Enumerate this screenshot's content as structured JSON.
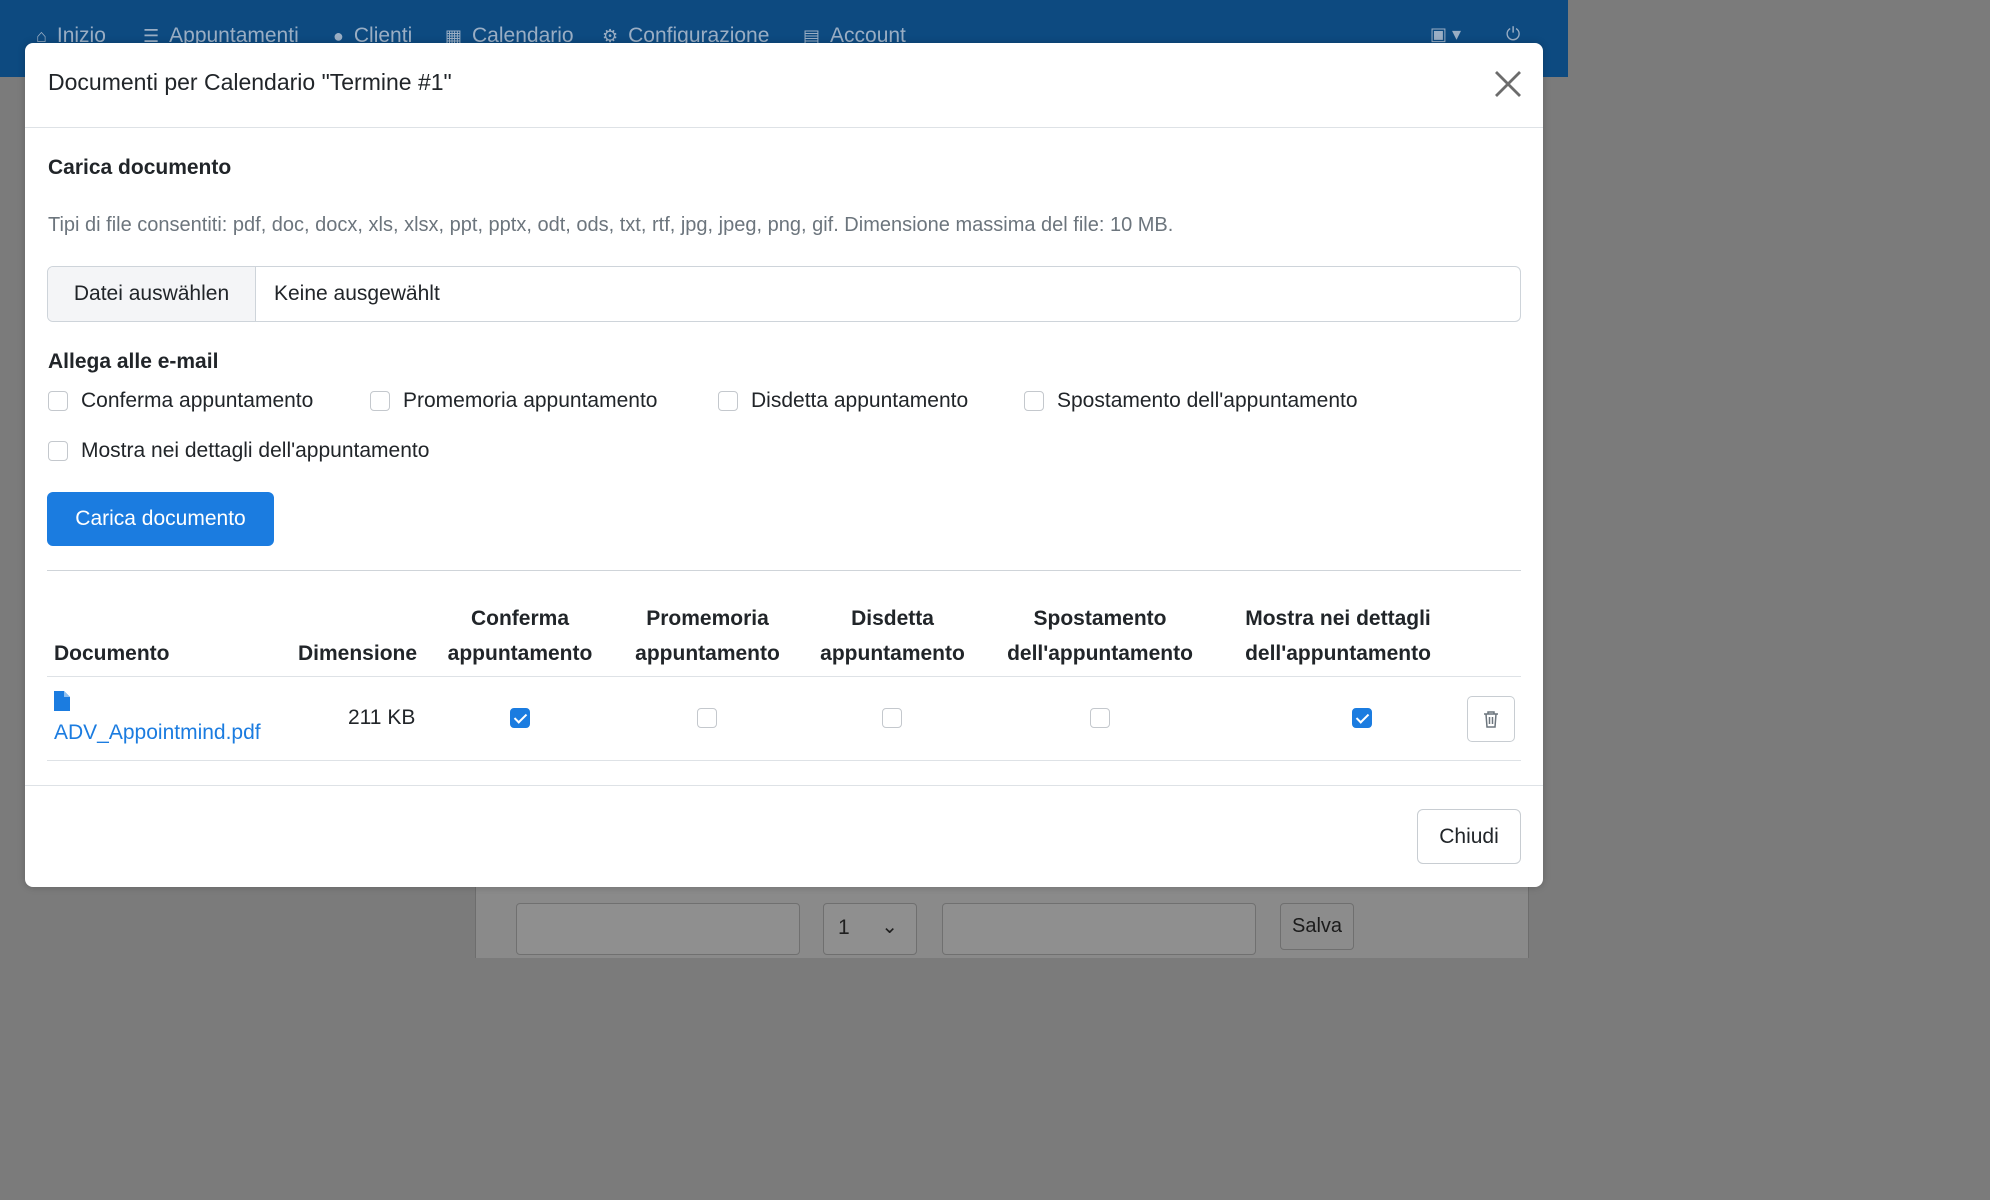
{
  "navbar": {
    "items": [
      {
        "label": "Inizio",
        "icon": "home-icon"
      },
      {
        "label": "Appuntamenti",
        "icon": "list-icon"
      },
      {
        "label": "Clienti",
        "icon": "user-icon"
      },
      {
        "label": "Calendario",
        "icon": "calendar-icon"
      },
      {
        "label": "Configurazione",
        "icon": "gear-icon"
      },
      {
        "label": "Account",
        "icon": "archive-icon"
      }
    ]
  },
  "background": {
    "select_value": "1",
    "save_label": "Salva"
  },
  "modal": {
    "title": "Documenti per Calendario \"Termine #1\"",
    "upload_section_title": "Carica documento",
    "allowed_types_hint": "Tipi di file consentiti: pdf, doc, docx, xls, xlsx, ppt, pptx, odt, ods, txt, rtf, jpg, jpeg, png, gif. Dimensione massima del file: 10 MB.",
    "file_input": {
      "button_label": "Datei auswählen",
      "value": "Keine ausgewählt"
    },
    "attach_title": "Allega alle e-mail",
    "options": [
      {
        "label": "Conferma appuntamento",
        "checked": false
      },
      {
        "label": "Promemoria appuntamento",
        "checked": false
      },
      {
        "label": "Disdetta appuntamento",
        "checked": false
      },
      {
        "label": "Spostamento dell'appuntamento",
        "checked": false
      },
      {
        "label": "Mostra nei dettagli dell'appuntamento",
        "checked": false
      }
    ],
    "upload_button": "Carica documento",
    "table": {
      "headers": {
        "document": "Documento",
        "size": "Dimensione",
        "confirm_1": "Conferma",
        "confirm_2": "appuntamento",
        "reminder_1": "Promemoria",
        "reminder_2": "appuntamento",
        "cancel_1": "Disdetta",
        "cancel_2": "appuntamento",
        "move_1": "Spostamento",
        "move_2": "dell'appuntamento",
        "details_1": "Mostra nei dettagli",
        "details_2": "dell'appuntamento"
      },
      "rows": [
        {
          "document": "ADV_Appointmind.pdf",
          "size": "211 KB",
          "confirm": true,
          "reminder": false,
          "cancel": false,
          "move": false,
          "details": true
        }
      ]
    },
    "close_footer_label": "Chiudi"
  },
  "colors": {
    "primary": "#1b7ce0",
    "navbar": "#0d4a80",
    "backdrop": "#7b7b7b"
  }
}
